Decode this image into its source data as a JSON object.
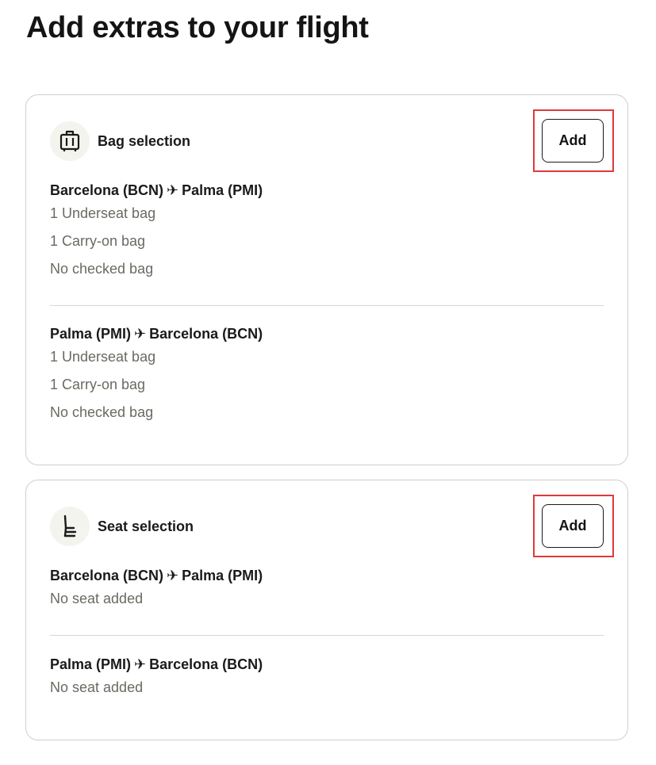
{
  "page": {
    "title": "Add extras to your flight"
  },
  "bag_selection": {
    "title": "Bag selection",
    "icon": "luggage-icon",
    "add_label": "Add",
    "segments": [
      {
        "origin": "Barcelona (BCN)",
        "destination": "Palma (PMI)",
        "items": [
          "1 Underseat bag",
          "1 Carry-on bag",
          "No checked bag"
        ]
      },
      {
        "origin": "Palma (PMI)",
        "destination": "Barcelona (BCN)",
        "items": [
          "1 Underseat bag",
          "1 Carry-on bag",
          "No checked bag"
        ]
      }
    ]
  },
  "seat_selection": {
    "title": "Seat selection",
    "icon": "seat-icon",
    "add_label": "Add",
    "segments": [
      {
        "origin": "Barcelona (BCN)",
        "destination": "Palma (PMI)",
        "items": [
          "No seat added"
        ]
      },
      {
        "origin": "Palma (PMI)",
        "destination": "Barcelona (BCN)",
        "items": [
          "No seat added"
        ]
      }
    ]
  },
  "colors": {
    "highlight": "#e03a3a",
    "icon_background": "#f3f4ee",
    "muted_text": "#6a6a62"
  }
}
